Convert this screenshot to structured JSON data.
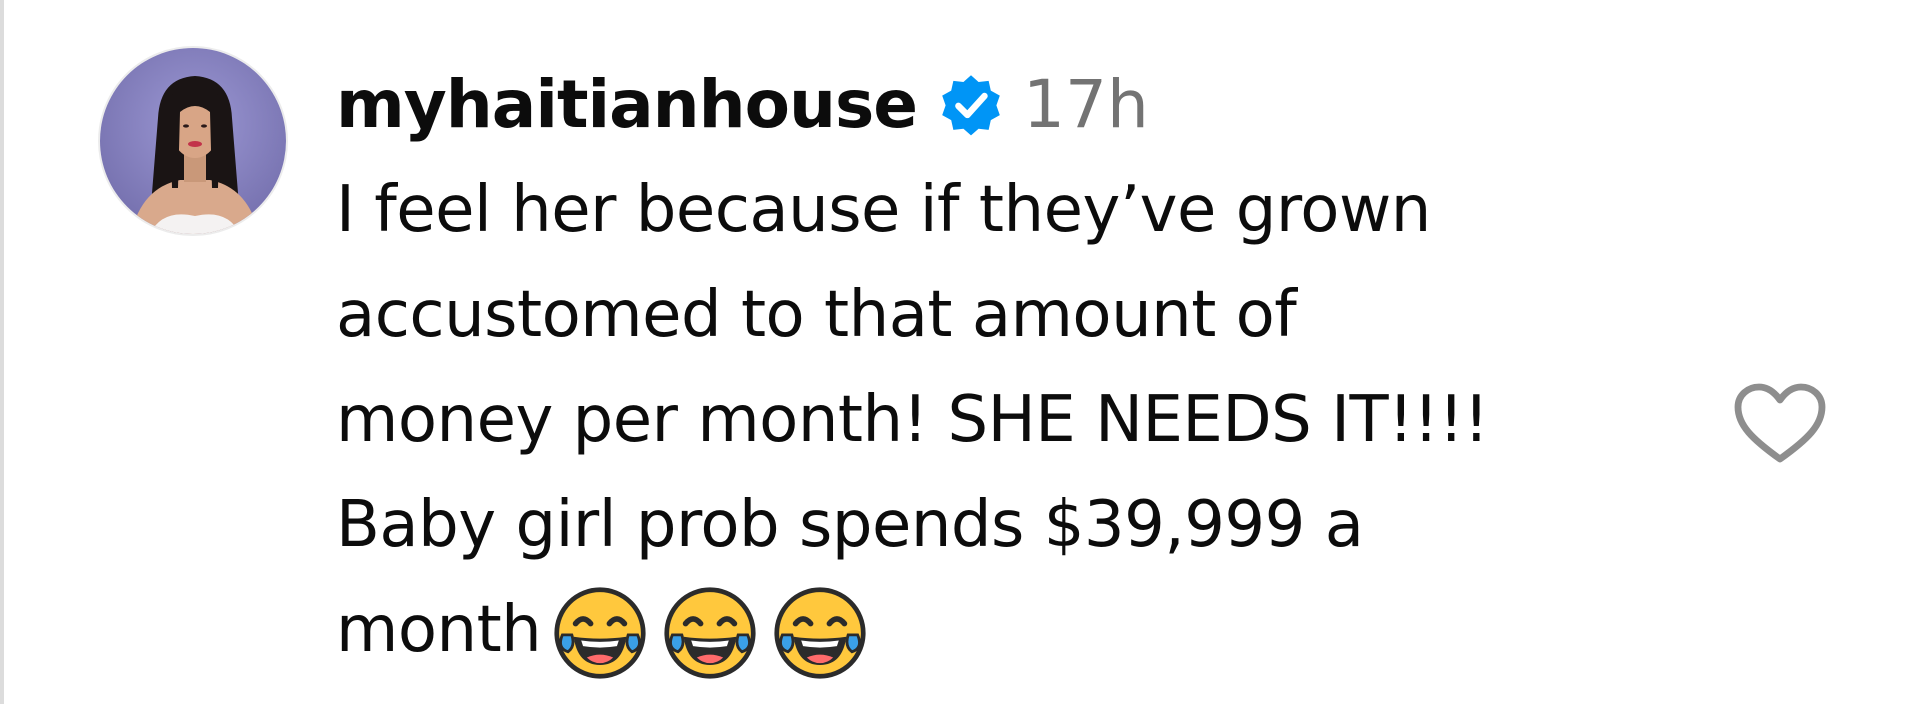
{
  "comment": {
    "username": "myhaitianhouse",
    "verified": true,
    "timestamp": "17h",
    "lines": [
      "I feel her because if they’ve grown",
      "accustomed to that amount of",
      "money per month! SHE NEEDS IT!!!!",
      "Baby girl prob spends $39,999 a",
      "month"
    ],
    "emojis": [
      "face-with-tears-of-joy",
      "face-with-tears-of-joy",
      "face-with-tears-of-joy"
    ]
  },
  "icons": {
    "verified_badge": "verified-badge-icon",
    "like": "heart-outline-icon"
  },
  "colors": {
    "verified_blue": "#0095f6",
    "timestamp_gray": "#737373",
    "text": "#0c0c0c"
  }
}
